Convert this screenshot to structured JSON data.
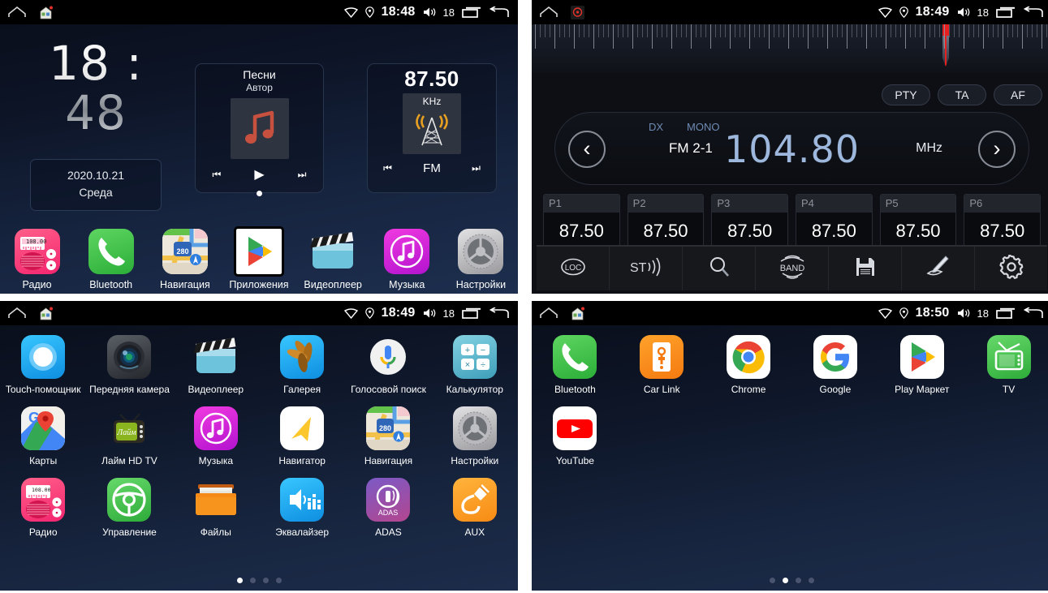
{
  "screens": {
    "home": {
      "statusbar": {
        "home_icon": "home-icon",
        "house_icon": "house-app-icon",
        "wifi_icon": "wifi-icon",
        "gps_icon": "location-icon",
        "time": "18:48",
        "volume_icon": "volume-icon",
        "volume": "18",
        "recents_icon": "recents-icon",
        "back_icon": "back-icon"
      },
      "clock": "18 : 48",
      "clock_hours": "18",
      "clock_sep": ":",
      "clock_minutes": "48",
      "date": "2020.10.21",
      "weekday": "Среда",
      "music_widget": {
        "title": "Песни",
        "artist": "Автор",
        "prev": "⏮",
        "play": "▶",
        "next": "⏭"
      },
      "radio_widget": {
        "frequency": "87.50",
        "unit": "KHz",
        "band": "FM",
        "prev": "⏮",
        "next": "⏭"
      },
      "page_dots": {
        "count": 1,
        "active": 0
      },
      "dock": [
        {
          "label": "Радио",
          "icon": "radio-icon"
        },
        {
          "label": "Bluetooth",
          "icon": "phone-icon"
        },
        {
          "label": "Навигация",
          "icon": "maps-280-icon"
        },
        {
          "label": "Приложения",
          "icon": "play-store-icon",
          "highlight": true
        },
        {
          "label": "Видеоплеер",
          "icon": "clapperboard-icon"
        },
        {
          "label": "Музыка",
          "icon": "music-note-icon"
        },
        {
          "label": "Настройки",
          "icon": "gear-icon"
        }
      ]
    },
    "radio": {
      "statusbar": {
        "home_icon": "home-icon",
        "app_icon": "radio-status-icon",
        "wifi_icon": "wifi-icon",
        "gps_icon": "location-icon",
        "time": "18:49",
        "volume_icon": "volume-icon",
        "volume": "18",
        "recents_icon": "recents-icon",
        "back_icon": "back-icon"
      },
      "rds_buttons": [
        "PTY",
        "TA",
        "AF"
      ],
      "dx": "DX",
      "mono": "MONO",
      "prev_icon": "chevron-left-icon",
      "next_icon": "chevron-right-icon",
      "band": "FM 2-1",
      "frequency": "104.80",
      "unit": "MHz",
      "presets": [
        {
          "name": "P1",
          "value": "87.50"
        },
        {
          "name": "P2",
          "value": "87.50"
        },
        {
          "name": "P3",
          "value": "87.50"
        },
        {
          "name": "P4",
          "value": "87.50"
        },
        {
          "name": "P5",
          "value": "87.50"
        },
        {
          "name": "P6",
          "value": "87.50"
        }
      ],
      "toolbar": [
        {
          "label": "LOC",
          "icon": "loc-icon"
        },
        {
          "label": "ST",
          "icon": "stereo-icon"
        },
        {
          "label": "",
          "icon": "search-icon"
        },
        {
          "label": "BAND",
          "icon": "band-icon"
        },
        {
          "label": "",
          "icon": "save-icon"
        },
        {
          "label": "",
          "icon": "edit-pen-icon"
        },
        {
          "label": "",
          "icon": "gear-icon"
        }
      ]
    },
    "drawer": {
      "statusbar": {
        "home_icon": "home-icon",
        "house_icon": "house-app-icon",
        "wifi_icon": "wifi-icon",
        "gps_icon": "location-icon",
        "time": "18:49",
        "volume_icon": "volume-icon",
        "volume": "18",
        "recents_icon": "recents-icon",
        "back_icon": "back-icon"
      },
      "apps": [
        {
          "label": "Touch-помощник",
          "icon": "touch-assist-icon"
        },
        {
          "label": "Передняя камера",
          "icon": "front-camera-icon"
        },
        {
          "label": "Видеоплеер",
          "icon": "clapperboard-icon"
        },
        {
          "label": "Галерея",
          "icon": "gallery-icon"
        },
        {
          "label": "Голосовой поиск",
          "icon": "voice-search-icon"
        },
        {
          "label": "Калькулятор",
          "icon": "calculator-icon"
        },
        {
          "label": "Карты",
          "icon": "google-maps-icon"
        },
        {
          "label": "Лайм HD TV",
          "icon": "lime-tv-icon"
        },
        {
          "label": "Музыка",
          "icon": "music-note-icon"
        },
        {
          "label": "Навигатор",
          "icon": "navigator-arrow-icon"
        },
        {
          "label": "Навигация",
          "icon": "maps-280-icon"
        },
        {
          "label": "Настройки",
          "icon": "gear-icon"
        },
        {
          "label": "Радио",
          "icon": "radio-icon"
        },
        {
          "label": "Управление",
          "icon": "steering-wheel-icon"
        },
        {
          "label": "Файлы",
          "icon": "folder-icon"
        },
        {
          "label": "Эквалайзер",
          "icon": "equalizer-icon"
        },
        {
          "label": "ADAS",
          "icon": "adas-icon"
        },
        {
          "label": "AUX",
          "icon": "aux-jack-icon"
        }
      ],
      "page_dots": {
        "count": 4,
        "active": 0
      }
    },
    "drawer2": {
      "statusbar": {
        "home_icon": "home-icon",
        "house_icon": "house-app-icon",
        "wifi_icon": "wifi-icon",
        "gps_icon": "location-icon",
        "time": "18:50",
        "volume_icon": "volume-icon",
        "volume": "18",
        "recents_icon": "recents-icon",
        "back_icon": "back-icon"
      },
      "apps": [
        {
          "label": "Bluetooth",
          "icon": "phone-icon"
        },
        {
          "label": "Car Link",
          "icon": "car-link-icon"
        },
        {
          "label": "Chrome",
          "icon": "chrome-icon"
        },
        {
          "label": "Google",
          "icon": "google-g-icon"
        },
        {
          "label": "Play Маркет",
          "icon": "play-store-icon"
        },
        {
          "label": "TV",
          "icon": "tv-icon"
        },
        {
          "label": "YouTube",
          "icon": "youtube-icon"
        }
      ],
      "page_dots": {
        "count": 4,
        "active": 1
      }
    }
  },
  "colors": {
    "status_bg": "#000000",
    "home_bg_top": "#0a0f1c",
    "home_bg_bottom": "#1d2e4e",
    "radio_bg": "#0d0f14",
    "accent_blue": "#9db8dc",
    "needle_red": "#e81f1f"
  }
}
